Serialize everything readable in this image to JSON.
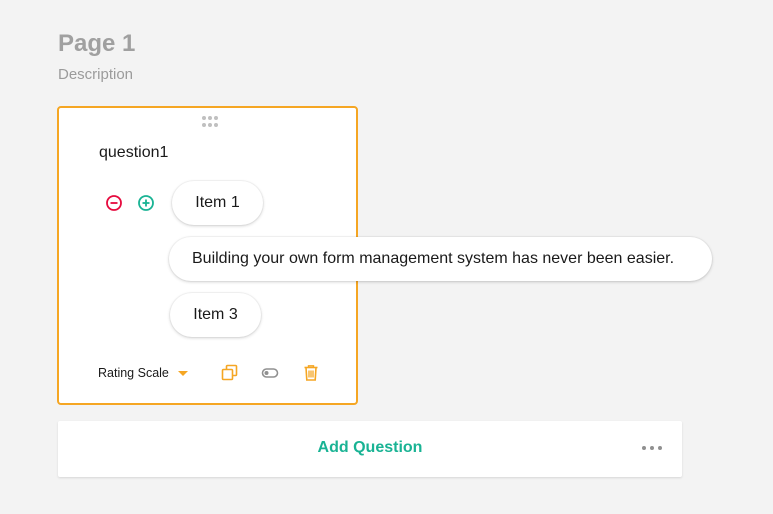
{
  "page": {
    "title": "Page 1",
    "description": "Description"
  },
  "question": {
    "title": "question1",
    "choices": [
      {
        "label": "Item 1"
      },
      {
        "label": "Building your own form management system has never been easier."
      },
      {
        "label": "Item 3"
      }
    ],
    "type_label": "Rating Scale",
    "icons": {
      "remove": "remove-circle-icon",
      "add": "add-circle-icon",
      "duplicate": "duplicate-icon",
      "required_toggle": "toggle-icon",
      "delete": "trash-icon",
      "drag": "drag-handle-icon"
    }
  },
  "footer": {
    "add_question_label": "Add Question",
    "more_icon": "more-horizontal-icon"
  },
  "colors": {
    "accent": "#f5a623",
    "primary": "#19b394",
    "danger": "#e60a3e",
    "muted": "#a0a0a0",
    "background": "#f3f3f3"
  }
}
